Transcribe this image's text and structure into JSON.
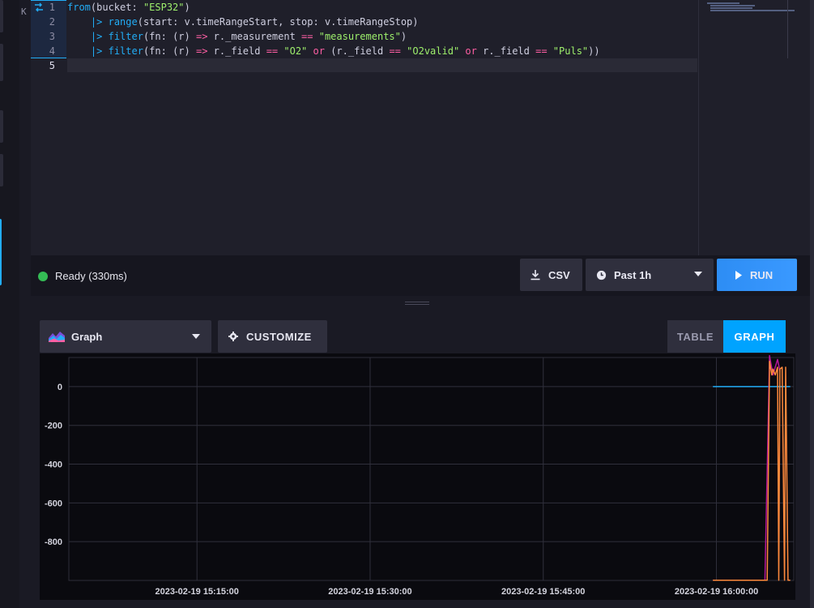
{
  "editor": {
    "rail_letter": "K",
    "line_numbers": [
      "1",
      "2",
      "3",
      "4",
      "5"
    ],
    "lines": [
      [
        {
          "t": "from",
          "c": "fn"
        },
        {
          "t": "(bucket: ",
          "c": ""
        },
        {
          "t": "\"ESP32\"",
          "c": "str"
        },
        {
          "t": ")",
          "c": ""
        }
      ],
      [
        {
          "t": "    ",
          "c": ""
        },
        {
          "t": "|>",
          "c": "pipe"
        },
        {
          "t": " ",
          "c": ""
        },
        {
          "t": "range",
          "c": "fn"
        },
        {
          "t": "(start: v.timeRangeStart, stop: v.timeRangeStop)",
          "c": ""
        }
      ],
      [
        {
          "t": "    ",
          "c": ""
        },
        {
          "t": "|>",
          "c": "pipe"
        },
        {
          "t": " ",
          "c": ""
        },
        {
          "t": "filter",
          "c": "fn"
        },
        {
          "t": "(fn: (r) ",
          "c": ""
        },
        {
          "t": "=>",
          "c": "op"
        },
        {
          "t": " r._measurement ",
          "c": ""
        },
        {
          "t": "==",
          "c": "op"
        },
        {
          "t": " ",
          "c": ""
        },
        {
          "t": "\"measurements\"",
          "c": "str"
        },
        {
          "t": ")",
          "c": ""
        }
      ],
      [
        {
          "t": "    ",
          "c": ""
        },
        {
          "t": "|>",
          "c": "pipe"
        },
        {
          "t": " ",
          "c": ""
        },
        {
          "t": "filter",
          "c": "fn"
        },
        {
          "t": "(fn: (r) ",
          "c": ""
        },
        {
          "t": "=>",
          "c": "op"
        },
        {
          "t": " r._field ",
          "c": ""
        },
        {
          "t": "==",
          "c": "op"
        },
        {
          "t": " ",
          "c": ""
        },
        {
          "t": "\"O2\"",
          "c": "str"
        },
        {
          "t": " ",
          "c": ""
        },
        {
          "t": "or",
          "c": "op"
        },
        {
          "t": " (r._field ",
          "c": ""
        },
        {
          "t": "==",
          "c": "op"
        },
        {
          "t": " ",
          "c": ""
        },
        {
          "t": "\"O2valid\"",
          "c": "str"
        },
        {
          "t": " ",
          "c": ""
        },
        {
          "t": "or",
          "c": "op"
        },
        {
          "t": " r._field ",
          "c": ""
        },
        {
          "t": "==",
          "c": "op"
        },
        {
          "t": " ",
          "c": ""
        },
        {
          "t": "\"Puls\"",
          "c": "str"
        },
        {
          "t": "))",
          "c": ""
        }
      ],
      []
    ]
  },
  "status": {
    "ready_text": "Ready (330ms)",
    "ready_color": "#34bb55"
  },
  "toolbar": {
    "csv_label": "CSV",
    "time_range_label": "Past 1h",
    "run_label": "RUN"
  },
  "viz": {
    "type_label": "Graph",
    "customize_label": "CUSTOMIZE",
    "table_toggle_label": "TABLE",
    "graph_toggle_label": "GRAPH",
    "accent_color": "#00a3ff"
  },
  "chart_data": {
    "type": "line",
    "ylim": [
      -1000,
      150
    ],
    "y_ticks": [
      0,
      -200,
      -400,
      -600,
      -800
    ],
    "x_tick_labels": [
      "2023-02-19 15:15:00",
      "2023-02-19 15:30:00",
      "2023-02-19 15:45:00",
      "2023-02-19 16:00:00"
    ],
    "x_unit": "minutes after 2023-02-19 15:00:00",
    "xlim": [
      3.9,
      66.7
    ],
    "x_ticks": [
      15,
      30,
      45,
      60
    ],
    "series": [
      {
        "color": "#22adf6",
        "x": [
          59.7,
          66.4
        ],
        "y": [
          0,
          0
        ]
      },
      {
        "color": "#b4169a",
        "x": [
          59.7,
          64.2,
          64.6,
          64.9,
          65.3,
          65.5
        ],
        "y": [
          -999,
          -999,
          160,
          60,
          140,
          80
        ]
      },
      {
        "color": "#ff8a3d",
        "x": [
          59.7,
          64.4,
          64.6,
          64.8,
          64.9,
          65.1,
          65.3,
          65.4,
          65.5,
          65.7,
          65.9,
          66.0,
          66.2,
          66.4
        ],
        "y": [
          -999,
          -999,
          130,
          60,
          90,
          60,
          100,
          -999,
          90,
          100,
          -999,
          100,
          -999,
          -999
        ]
      }
    ]
  }
}
